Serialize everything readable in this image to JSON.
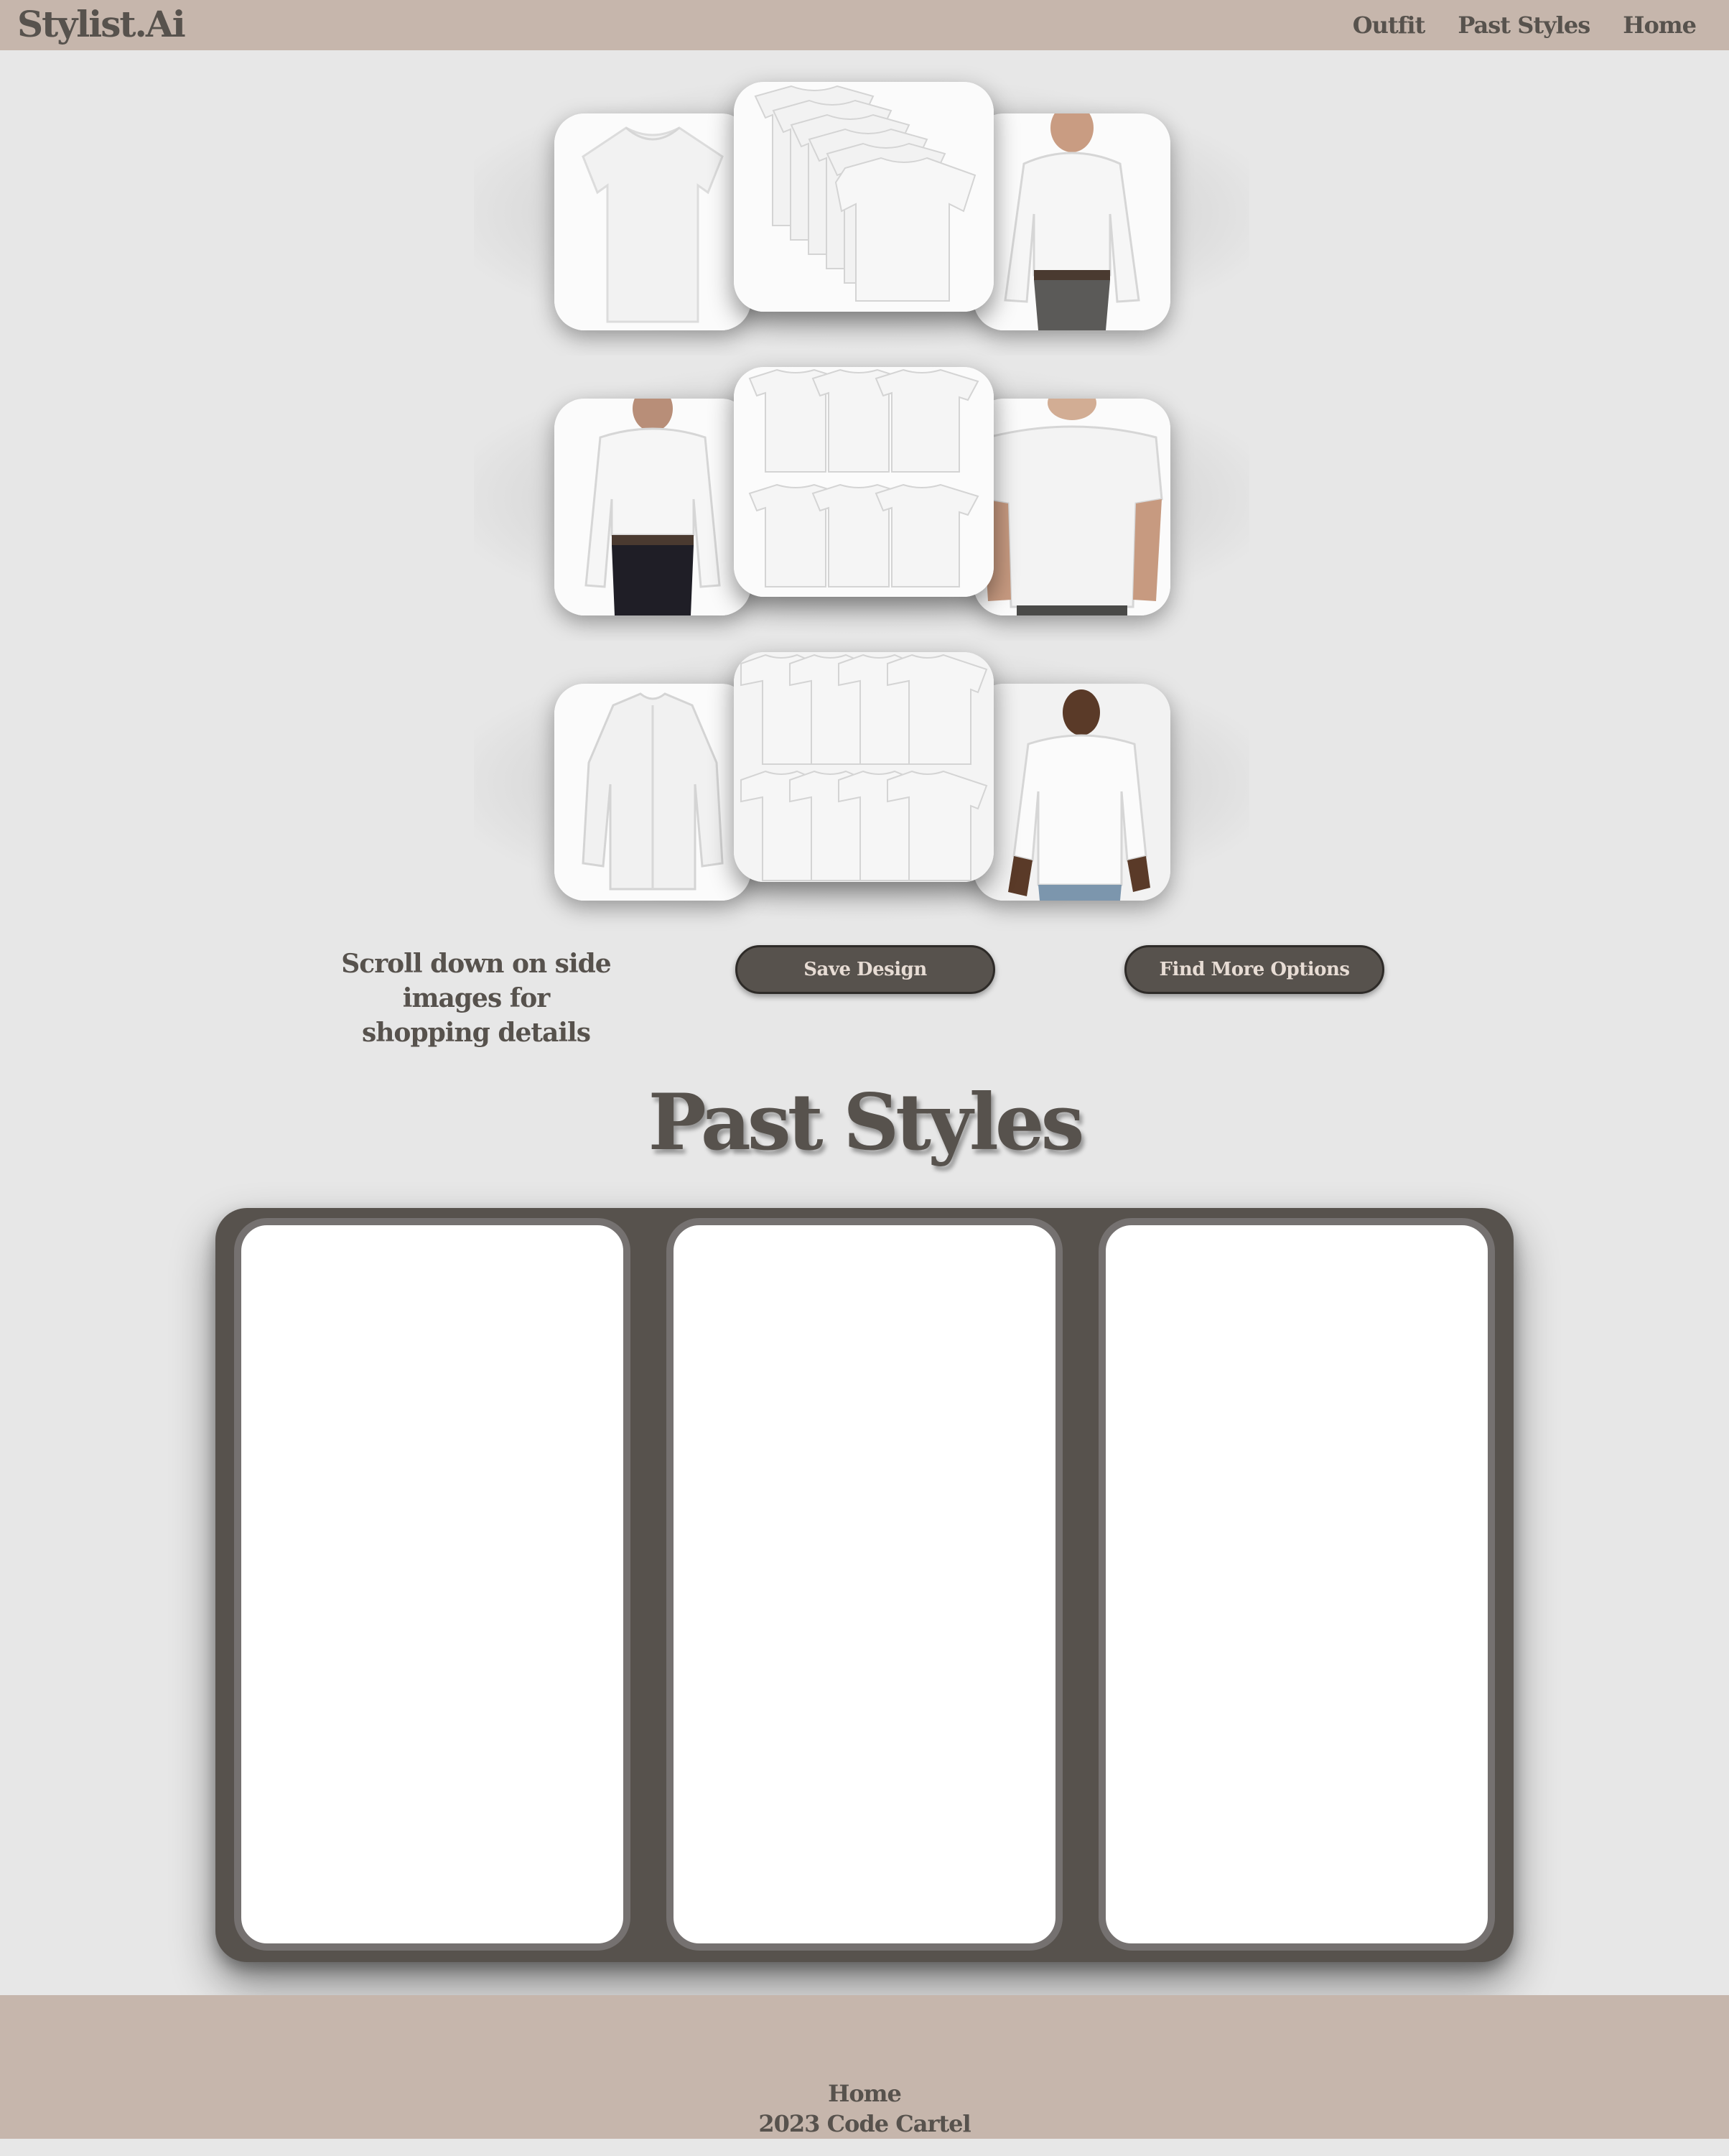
{
  "nav": {
    "logo": "Stylist.Ai",
    "links": [
      "Outfit",
      "Past Styles",
      "Home"
    ]
  },
  "carousel": {
    "rows": [
      {
        "left": "white-tshirt",
        "center": "white-tshirt-stack",
        "right": "man-white-dress-shirt"
      },
      {
        "left": "man-white-dress-shirt",
        "center": "white-tshirt-6-pack",
        "right": "man-white-tshirt"
      },
      {
        "left": "white-dress-shirt",
        "center": "white-tshirt-8-pack",
        "right": "man-white-casual-shirt"
      }
    ]
  },
  "controls": {
    "hint": "Scroll down on side images for shopping details",
    "save_label": "Save Design",
    "more_label": "Find More Options"
  },
  "past_styles": {
    "title": "Past Styles",
    "cards": [
      "",
      "",
      ""
    ]
  },
  "footer": {
    "home_label": "Home",
    "copyright": "2023 Code Cartel"
  },
  "colors": {
    "nav_bg": "#c6b6ac",
    "page_bg": "#e7e7e7",
    "accent": "#57524d",
    "button_text": "#e7dcd4"
  }
}
